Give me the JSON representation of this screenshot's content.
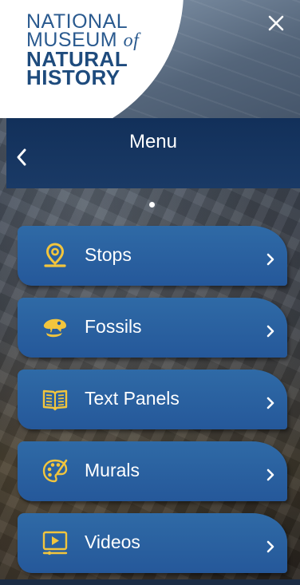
{
  "logo": {
    "line1": "NATIONAL",
    "line2_main": "MUSEUM",
    "line2_of": "of",
    "line3": "NATURAL",
    "line4": "HISTORY"
  },
  "close_icon": "close-icon",
  "header": {
    "title": "Menu",
    "back_icon": "chevron-left-icon"
  },
  "colors": {
    "header_bg": "#12305a",
    "menu_item_bg": "#2f6aa6",
    "icon_yellow": "#f2c53d",
    "logo_blue": "#2a5a8f"
  },
  "menu": {
    "items": [
      {
        "label": "Stops",
        "icon": "location-pin-icon"
      },
      {
        "label": "Fossils",
        "icon": "dinosaur-skull-icon"
      },
      {
        "label": "Text Panels",
        "icon": "open-book-icon"
      },
      {
        "label": "Murals",
        "icon": "palette-icon"
      },
      {
        "label": "Videos",
        "icon": "video-play-icon"
      }
    ]
  }
}
